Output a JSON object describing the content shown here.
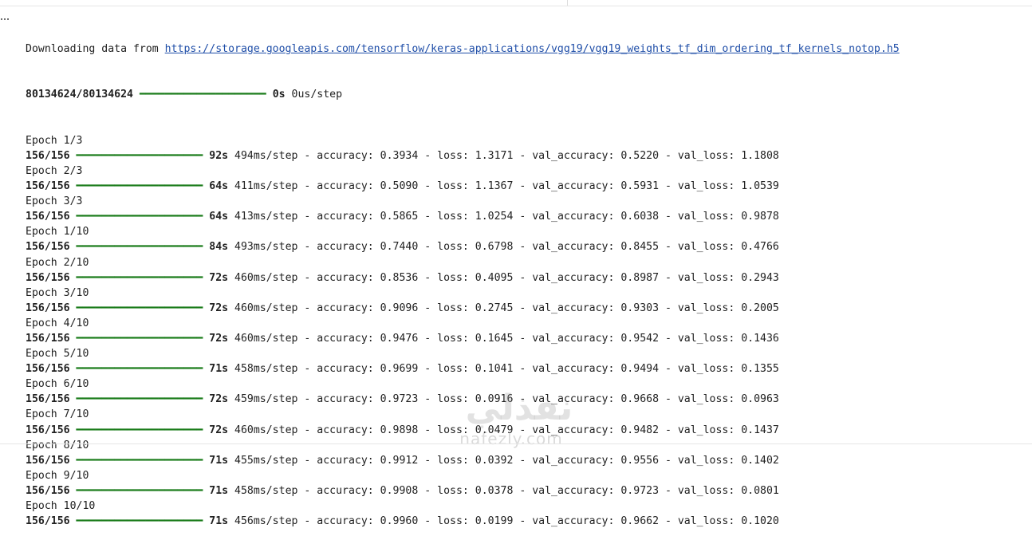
{
  "download": {
    "prefix": "Downloading data from ",
    "url": "https://storage.googleapis.com/tensorflow/keras-applications/vgg19/vgg19_weights_tf_dim_ordering_tf_kernels_notop.h5",
    "progress_count": "80134624/80134624",
    "progress_bar": "━━━━━━━━━━━━━━━━━━━━",
    "time": "0s",
    "step_time": " 0us/step"
  },
  "progress_fraction": 1.0,
  "epochs": [
    {
      "epoch": "Epoch 1/3",
      "steps": "156/156",
      "bar": "━━━━━━━━━━━━━━━━━━━━",
      "time": "92s",
      "step_time": " 494ms/step",
      "metrics": " - accuracy: 0.3934 - loss: 1.3171 - val_accuracy: 0.5220 - val_loss: 1.1808"
    },
    {
      "epoch": "Epoch 2/3",
      "steps": "156/156",
      "bar": "━━━━━━━━━━━━━━━━━━━━",
      "time": "64s",
      "step_time": " 411ms/step",
      "metrics": " - accuracy: 0.5090 - loss: 1.1367 - val_accuracy: 0.5931 - val_loss: 1.0539"
    },
    {
      "epoch": "Epoch 3/3",
      "steps": "156/156",
      "bar": "━━━━━━━━━━━━━━━━━━━━",
      "time": "64s",
      "step_time": " 413ms/step",
      "metrics": " - accuracy: 0.5865 - loss: 1.0254 - val_accuracy: 0.6038 - val_loss: 0.9878"
    },
    {
      "epoch": "Epoch 1/10",
      "steps": "156/156",
      "bar": "━━━━━━━━━━━━━━━━━━━━",
      "time": "84s",
      "step_time": " 493ms/step",
      "metrics": " - accuracy: 0.7440 - loss: 0.6798 - val_accuracy: 0.8455 - val_loss: 0.4766"
    },
    {
      "epoch": "Epoch 2/10",
      "steps": "156/156",
      "bar": "━━━━━━━━━━━━━━━━━━━━",
      "time": "72s",
      "step_time": " 460ms/step",
      "metrics": " - accuracy: 0.8536 - loss: 0.4095 - val_accuracy: 0.8987 - val_loss: 0.2943"
    },
    {
      "epoch": "Epoch 3/10",
      "steps": "156/156",
      "bar": "━━━━━━━━━━━━━━━━━━━━",
      "time": "72s",
      "step_time": " 460ms/step",
      "metrics": " - accuracy: 0.9096 - loss: 0.2745 - val_accuracy: 0.9303 - val_loss: 0.2005"
    },
    {
      "epoch": "Epoch 4/10",
      "steps": "156/156",
      "bar": "━━━━━━━━━━━━━━━━━━━━",
      "time": "72s",
      "step_time": " 460ms/step",
      "metrics": " - accuracy: 0.9476 - loss: 0.1645 - val_accuracy: 0.9542 - val_loss: 0.1436"
    },
    {
      "epoch": "Epoch 5/10",
      "steps": "156/156",
      "bar": "━━━━━━━━━━━━━━━━━━━━",
      "time": "71s",
      "step_time": " 458ms/step",
      "metrics": " - accuracy: 0.9699 - loss: 0.1041 - val_accuracy: 0.9494 - val_loss: 0.1355"
    },
    {
      "epoch": "Epoch 6/10",
      "steps": "156/156",
      "bar": "━━━━━━━━━━━━━━━━━━━━",
      "time": "72s",
      "step_time": " 459ms/step",
      "metrics": " - accuracy: 0.9723 - loss: 0.0916 - val_accuracy: 0.9668 - val_loss: 0.0963"
    },
    {
      "epoch": "Epoch 7/10",
      "steps": "156/156",
      "bar": "━━━━━━━━━━━━━━━━━━━━",
      "time": "72s",
      "step_time": " 460ms/step",
      "metrics": " - accuracy: 0.9898 - loss: 0.0479 - val_accuracy: 0.9482 - val_loss: 0.1437"
    },
    {
      "epoch": "Epoch 8/10",
      "steps": "156/156",
      "bar": "━━━━━━━━━━━━━━━━━━━━",
      "time": "71s",
      "step_time": " 455ms/step",
      "metrics": " - accuracy: 0.9912 - loss: 0.0392 - val_accuracy: 0.9556 - val_loss: 0.1402"
    },
    {
      "epoch": "Epoch 9/10",
      "steps": "156/156",
      "bar": "━━━━━━━━━━━━━━━━━━━━",
      "time": "71s",
      "step_time": " 458ms/step",
      "metrics": " - accuracy: 0.9908 - loss: 0.0378 - val_accuracy: 0.9723 - val_loss: 0.0801"
    },
    {
      "epoch": "Epoch 10/10",
      "steps": "156/156",
      "bar": "━━━━━━━━━━━━━━━━━━━━",
      "time": "71s",
      "step_time": " 456ms/step",
      "metrics": " - accuracy: 0.9960 - loss: 0.0199 - val_accuracy: 0.9662 - val_loss: 0.1020"
    }
  ],
  "watermark": {
    "arabic": "نفذلي",
    "latin": "nafezly.com"
  },
  "colors": {
    "progress_bar": "#1a7c1a",
    "link": "#1f4ea8",
    "text": "#212121"
  },
  "icons": {
    "output_menu": "more-horizontal-icon"
  }
}
